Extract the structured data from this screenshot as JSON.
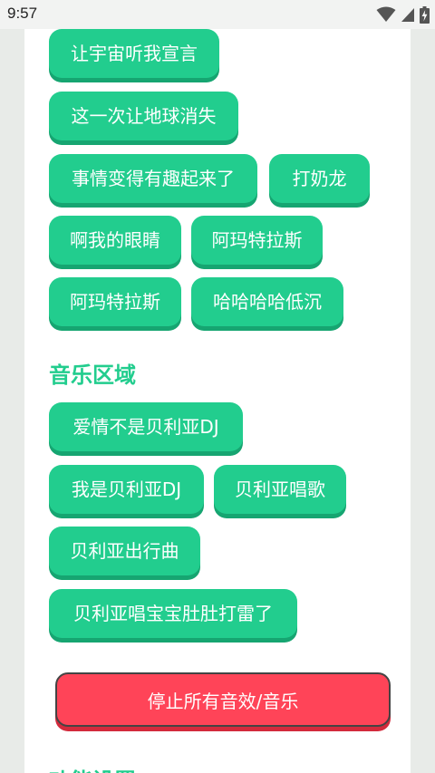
{
  "status_bar": {
    "time": "9:57"
  },
  "sound_buttons": [
    "让宇宙听我宣言",
    "这一次让地球消失",
    "事情变得有趣起来了",
    "打奶龙",
    "啊我的眼睛",
    "阿玛特拉斯",
    "阿玛特拉斯",
    "哈哈哈哈低沉"
  ],
  "music_section": {
    "title": "音乐区域",
    "buttons": [
      "爱情不是贝利亚DJ",
      "我是贝利亚DJ",
      "贝利亚唱歌",
      "贝利亚出行曲",
      "贝利亚唱宝宝肚肚打雷了"
    ]
  },
  "stop_all_label": "停止所有音效/音乐",
  "settings_section": {
    "title": "功能设置"
  },
  "colors": {
    "accent_green": "#22cd8e",
    "accent_green_shadow": "#16a571",
    "stop_red": "#ff4458",
    "page_bg": "#e8ebe8",
    "card_bg": "#ffffff"
  }
}
